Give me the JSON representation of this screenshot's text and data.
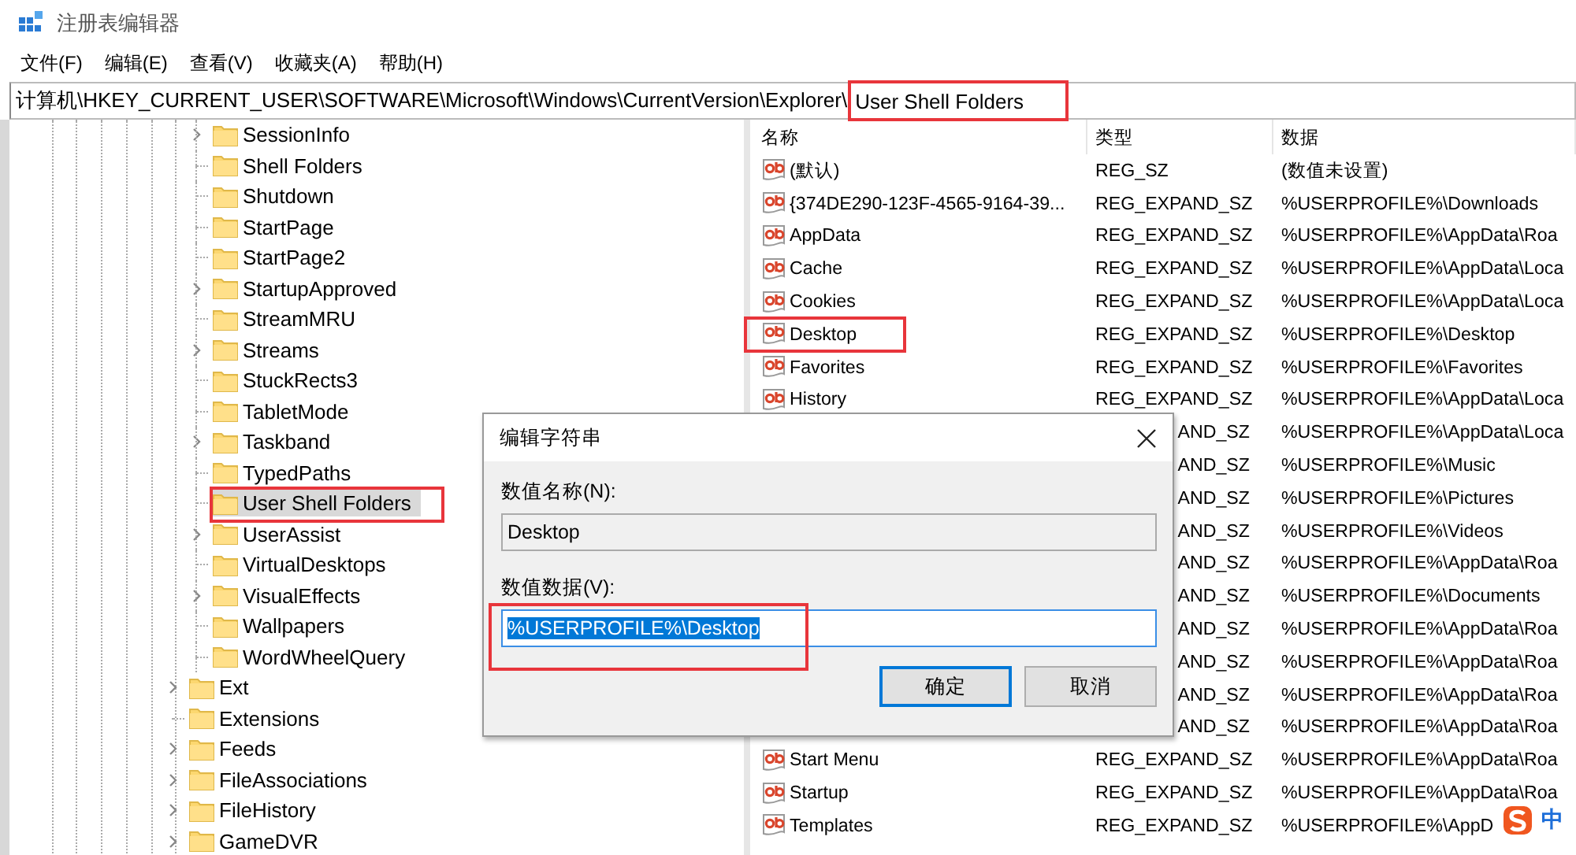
{
  "window": {
    "title": "注册表编辑器"
  },
  "menu": [
    "文件(F)",
    "编辑(E)",
    "查看(V)",
    "收藏夹(A)",
    "帮助(H)"
  ],
  "address_bar": {
    "path": "计算机\\HKEY_CURRENT_USER\\SOFTWARE\\Microsoft\\Windows\\CurrentVersion\\Explorer\\",
    "segment": "User Shell Folders",
    "highlighted": true
  },
  "tree": {
    "items": [
      {
        "children": [
          {
            "label": "SessionInfo",
            "expandable": true,
            "selected": false,
            "highlighted": false
          },
          {
            "label": "Shell Folders",
            "expandable": false,
            "selected": false,
            "highlighted": false
          },
          {
            "label": "Shutdown",
            "expandable": false,
            "selected": false,
            "highlighted": false
          },
          {
            "label": "StartPage",
            "expandable": false,
            "selected": false,
            "highlighted": false
          },
          {
            "label": "StartPage2",
            "expandable": false,
            "selected": false,
            "highlighted": false
          },
          {
            "label": "StartupApproved",
            "expandable": true,
            "selected": false,
            "highlighted": false
          },
          {
            "label": "StreamMRU",
            "expandable": false,
            "selected": false,
            "highlighted": false
          },
          {
            "label": "Streams",
            "expandable": true,
            "selected": false,
            "highlighted": false
          },
          {
            "label": "StuckRects3",
            "expandable": false,
            "selected": false,
            "highlighted": false
          },
          {
            "label": "TabletMode",
            "expandable": false,
            "selected": false,
            "highlighted": false
          },
          {
            "label": "Taskband",
            "expandable": true,
            "selected": false,
            "highlighted": false
          },
          {
            "label": "TypedPaths",
            "expandable": false,
            "selected": false,
            "highlighted": false
          },
          {
            "label": "User Shell Folders",
            "expandable": false,
            "selected": true,
            "highlighted": true
          },
          {
            "label": "UserAssist",
            "expandable": true,
            "selected": false,
            "highlighted": false
          },
          {
            "label": "VirtualDesktops",
            "expandable": false,
            "selected": false,
            "highlighted": false
          },
          {
            "label": "VisualEffects",
            "expandable": true,
            "selected": false,
            "highlighted": false
          },
          {
            "label": "Wallpapers",
            "expandable": false,
            "selected": false,
            "highlighted": false
          },
          {
            "label": "WordWheelQuery",
            "expandable": false,
            "selected": false,
            "highlighted": false
          }
        ]
      },
      {
        "label": "Ext",
        "expandable": true,
        "selected": false,
        "highlighted": false
      },
      {
        "label": "Extensions",
        "expandable": false,
        "selected": false,
        "highlighted": false
      },
      {
        "label": "Feeds",
        "expandable": true,
        "selected": false,
        "highlighted": false
      },
      {
        "label": "FileAssociations",
        "expandable": true,
        "selected": false,
        "highlighted": false
      },
      {
        "label": "FileHistory",
        "expandable": true,
        "selected": false,
        "highlighted": false
      },
      {
        "label": "GameDVR",
        "expandable": true,
        "selected": false,
        "highlighted": false
      }
    ]
  },
  "values_table": {
    "columns": [
      "名称",
      "类型",
      "数据"
    ],
    "rows": [
      {
        "name": "(默认)",
        "type": "REG_SZ",
        "data": "(数值未设置)",
        "highlighted": false
      },
      {
        "name": "{374DE290-123F-4565-9164-39...",
        "type": "REG_EXPAND_SZ",
        "data": "%USERPROFILE%\\Downloads",
        "highlighted": false
      },
      {
        "name": "AppData",
        "type": "REG_EXPAND_SZ",
        "data": "%USERPROFILE%\\AppData\\Roa",
        "highlighted": false
      },
      {
        "name": "Cache",
        "type": "REG_EXPAND_SZ",
        "data": "%USERPROFILE%\\AppData\\Loca",
        "highlighted": false
      },
      {
        "name": "Cookies",
        "type": "REG_EXPAND_SZ",
        "data": "%USERPROFILE%\\AppData\\Loca",
        "highlighted": false
      },
      {
        "name": "Desktop",
        "type": "REG_EXPAND_SZ",
        "data": "%USERPROFILE%\\Desktop",
        "highlighted": true
      },
      {
        "name": "Favorites",
        "type": "REG_EXPAND_SZ",
        "data": "%USERPROFILE%\\Favorites",
        "highlighted": false
      },
      {
        "name": "History",
        "type": "REG_EXPAND_SZ",
        "data": "%USERPROFILE%\\AppData\\Loca",
        "highlighted": false
      },
      {
        "type": "AND_SZ",
        "data": "%USERPROFILE%\\AppData\\Loca",
        "highlighted": false
      },
      {
        "type": "AND_SZ",
        "data": "%USERPROFILE%\\Music",
        "highlighted": false
      },
      {
        "type": "AND_SZ",
        "data": "%USERPROFILE%\\Pictures",
        "highlighted": false
      },
      {
        "type": "AND_SZ",
        "data": "%USERPROFILE%\\Videos",
        "highlighted": false
      },
      {
        "type": "AND_SZ",
        "data": "%USERPROFILE%\\AppData\\Roa",
        "highlighted": false
      },
      {
        "type": "AND_SZ",
        "data": "%USERPROFILE%\\Documents",
        "highlighted": false
      },
      {
        "type": "AND_SZ",
        "data": "%USERPROFILE%\\AppData\\Roa",
        "highlighted": false
      },
      {
        "type": "AND_SZ",
        "data": "%USERPROFILE%\\AppData\\Roa",
        "highlighted": false
      },
      {
        "type": "AND_SZ",
        "data": "%USERPROFILE%\\AppData\\Roa",
        "highlighted": false
      },
      {
        "type": "AND_SZ",
        "data": "%USERPROFILE%\\AppData\\Roa",
        "highlighted": false
      },
      {
        "name": "Start Menu",
        "type": "REG_EXPAND_SZ",
        "data": "%USERPROFILE%\\AppData\\Roa",
        "highlighted": false
      },
      {
        "name": "Startup",
        "type": "REG_EXPAND_SZ",
        "data": "%USERPROFILE%\\AppData\\Roa",
        "highlighted": false
      },
      {
        "name": "Templates",
        "type": "REG_EXPAND_SZ",
        "data": "%USERPROFILE%\\AppD",
        "highlighted": false
      }
    ]
  },
  "dialog": {
    "title": "编辑字符串",
    "name_label": "数值名称(N):",
    "name_value": "Desktop",
    "data_label": "数值数据(V):",
    "data_value": "%USERPROFILE%\\Desktop",
    "data_selected": true,
    "data_highlighted": true,
    "buttons": [
      {
        "label": "确定",
        "default": true
      },
      {
        "label": "取消",
        "default": false
      }
    ]
  },
  "ime_indicator": {
    "mode": "中"
  }
}
